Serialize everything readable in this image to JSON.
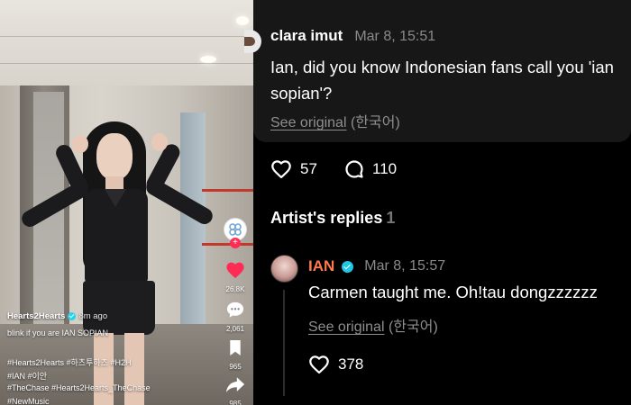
{
  "video": {
    "username": "Hearts2Hearts",
    "posted_time": "8m ago",
    "caption": "blink if you are IAN SOPIAN",
    "hashtags_line1": "#Hearts2Hearts #하츠투하츠 #H2H",
    "hashtags_line2": "#IAN #이안",
    "hashtags_line3": "#TheChase #Hearts2Hearts_TheChase",
    "hashtags_line4": "#NewMusic",
    "likes": "26.8K",
    "comments": "2,061",
    "bookmarks": "965",
    "shares": "985",
    "colors": {
      "like": "#fe2c55",
      "follow_badge": "#fe2c55",
      "verified": "#20d5ec"
    }
  },
  "comment": {
    "author": "clara imut",
    "time": "Mar 8, 15:51",
    "text": "Ian, did you know Indonesian fans call you 'ian sopian'?",
    "see_original": "See original",
    "language": "(한국어)",
    "likes": "57",
    "replies": "110"
  },
  "artist_replies": {
    "title": "Artist's replies",
    "count": "1",
    "reply": {
      "author": "IAN",
      "time": "Mar 8, 15:57",
      "text": "Carmen taught me. Oh!tau dongzzzzzz",
      "see_original": "See original",
      "language": "(한국어)",
      "likes": "378",
      "name_color": "#ff7a4d"
    }
  }
}
